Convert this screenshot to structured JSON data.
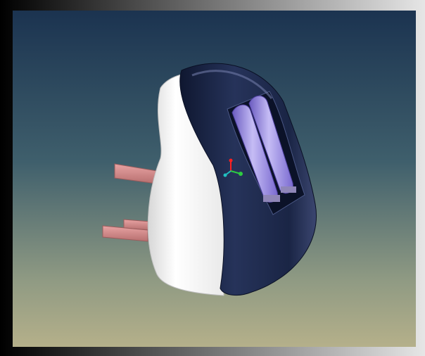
{
  "viewport": {
    "background_top": "#1b3350",
    "background_bottom": "#b5b08a"
  },
  "model": {
    "body_color": "#1f2b49",
    "shell_color": "#ffffff",
    "battery_color": "#9f8ee6",
    "pin_color": "#d88989",
    "battery_count": 2,
    "pin_count": 3
  },
  "axis_triad": {
    "x_color": "#2ecc40",
    "y_color": "#ff2020",
    "z_color": "#20c0c0"
  }
}
